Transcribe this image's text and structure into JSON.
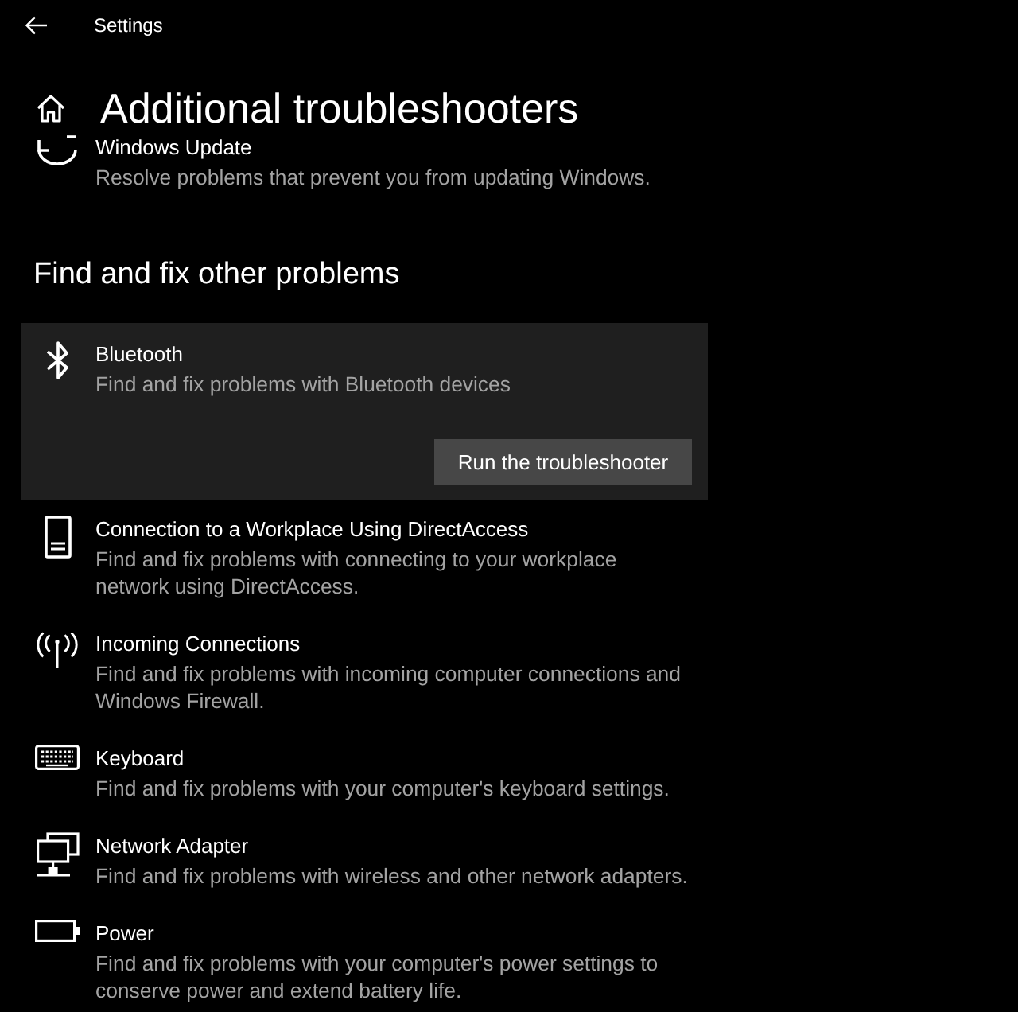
{
  "header": {
    "title": "Settings"
  },
  "page": {
    "title": "Additional troubleshooters"
  },
  "partial_item": {
    "title": "Windows Update",
    "description": "Resolve problems that prevent you from updating Windows."
  },
  "section": {
    "heading": "Find and fix other problems",
    "run_button": "Run the troubleshooter",
    "items": [
      {
        "title": "Bluetooth",
        "description": "Find and fix problems with Bluetooth devices",
        "selected": true
      },
      {
        "title": "Connection to a Workplace Using DirectAccess",
        "description": "Find and fix problems with connecting to your workplace network using DirectAccess.",
        "selected": false
      },
      {
        "title": "Incoming Connections",
        "description": "Find and fix problems with incoming computer connections and Windows Firewall.",
        "selected": false
      },
      {
        "title": "Keyboard",
        "description": "Find and fix problems with your computer's keyboard settings.",
        "selected": false
      },
      {
        "title": "Network Adapter",
        "description": "Find and fix problems with wireless and other network adapters.",
        "selected": false
      },
      {
        "title": "Power",
        "description": "Find and fix problems with your computer's power settings to conserve power and extend battery life.",
        "selected": false
      }
    ]
  }
}
